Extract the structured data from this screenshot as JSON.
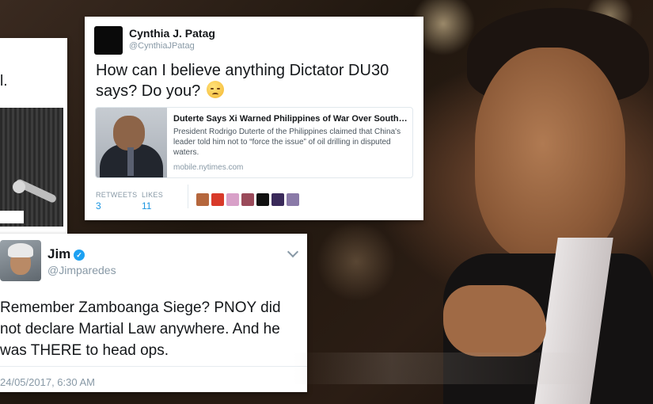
{
  "left_tweet": {
    "text_fragment": "l."
  },
  "cynthia_tweet": {
    "display_name": "Cynthia J. Patag",
    "handle": "@CynthiaJPatag",
    "text": "How can I believe anything Dictator DU30 says?  Do you?",
    "emoji": "pensive-face-emoji",
    "link_card": {
      "title": "Duterte Says Xi Warned Philippines of War Over South Chi...",
      "description": "President Rodrigo Duterte of the Philippines claimed that China's leader told him not to “force the issue” of oil drilling in disputed waters.",
      "url": "mobile.nytimes.com"
    },
    "stats": {
      "retweets_label": "RETWEETS",
      "retweets_value": "3",
      "likes_label": "LIKES",
      "likes_value": "11"
    },
    "liker_colors": [
      "#b5673d",
      "#d83a2a",
      "#d8a0c8",
      "#9a4a5a",
      "#111111",
      "#3a2a5a",
      "#8a7aa8"
    ]
  },
  "jim_tweet": {
    "display_name": "Jim",
    "handle": "@Jimparedes",
    "text": "Remember Zamboanga Siege? PNOY did not declare Martial Law anywhere. And he was THERE to head ops.",
    "date": "24/05/2017, 6:30 AM"
  },
  "colors": {
    "link_blue": "#1b95e0",
    "muted_gray": "#8899a6",
    "verified_blue": "#1da1f2"
  }
}
